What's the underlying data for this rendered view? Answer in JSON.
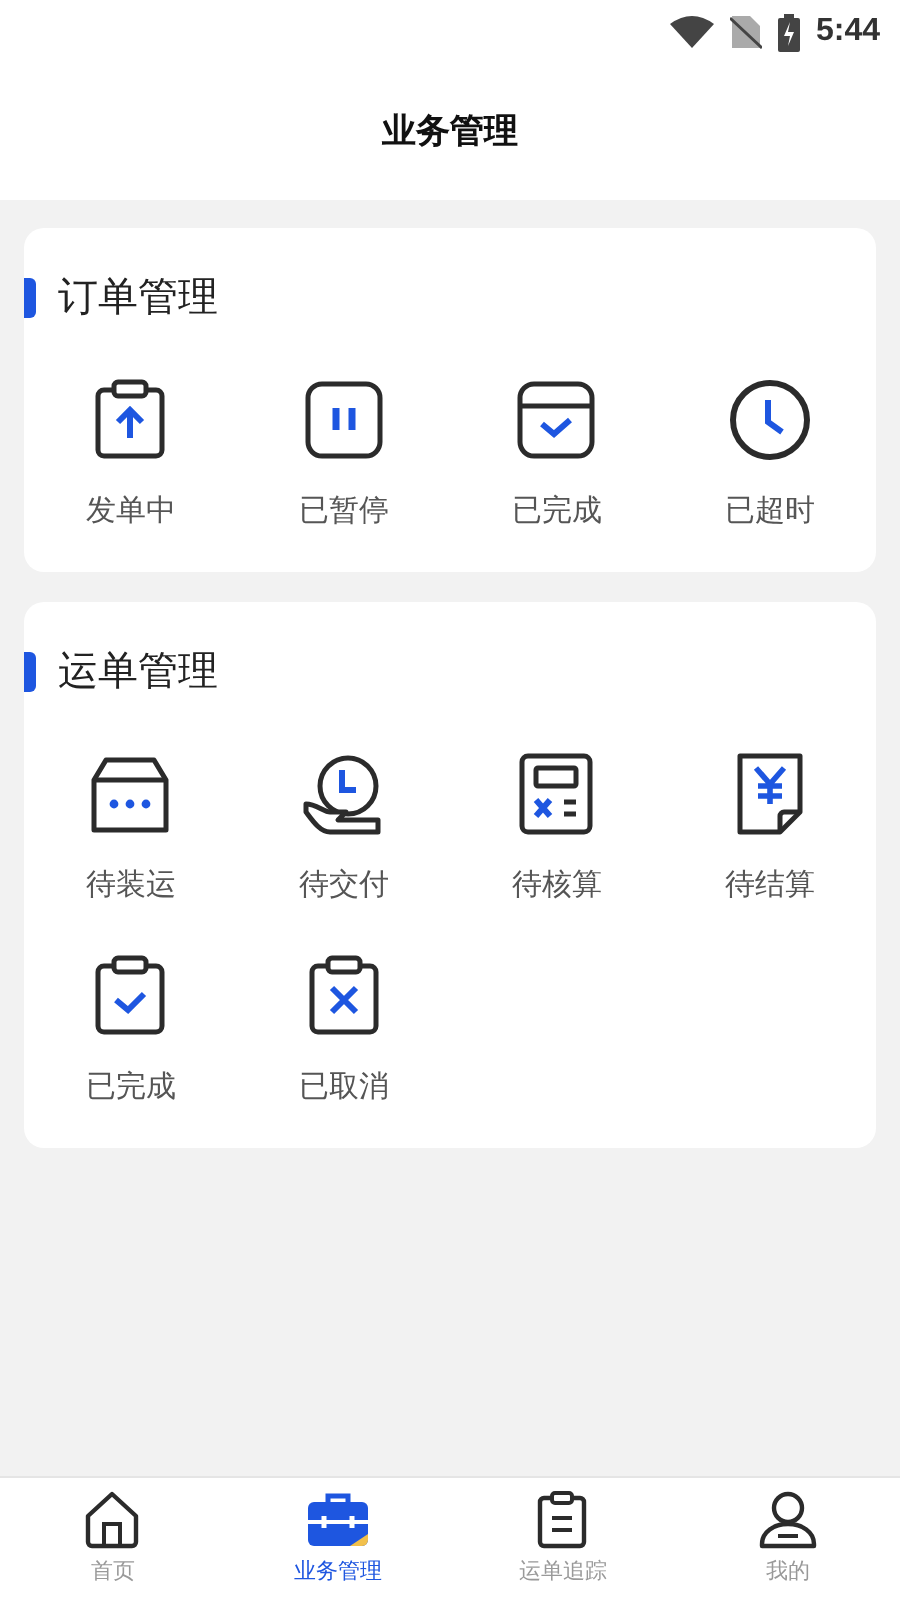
{
  "status_bar": {
    "time": "5:44"
  },
  "header": {
    "title": "业务管理"
  },
  "sections": [
    {
      "title": "订单管理",
      "items": [
        {
          "label": "发单中"
        },
        {
          "label": "已暂停"
        },
        {
          "label": "已完成"
        },
        {
          "label": "已超时"
        }
      ]
    },
    {
      "title": "运单管理",
      "items": [
        {
          "label": "待装运"
        },
        {
          "label": "待交付"
        },
        {
          "label": "待核算"
        },
        {
          "label": "待结算"
        },
        {
          "label": "已完成"
        },
        {
          "label": "已取消"
        }
      ]
    }
  ],
  "tab_bar": [
    {
      "label": "首页",
      "selected": false
    },
    {
      "label": "业务管理",
      "selected": true
    },
    {
      "label": "运单追踪",
      "selected": false
    },
    {
      "label": "我的",
      "selected": false
    }
  ]
}
